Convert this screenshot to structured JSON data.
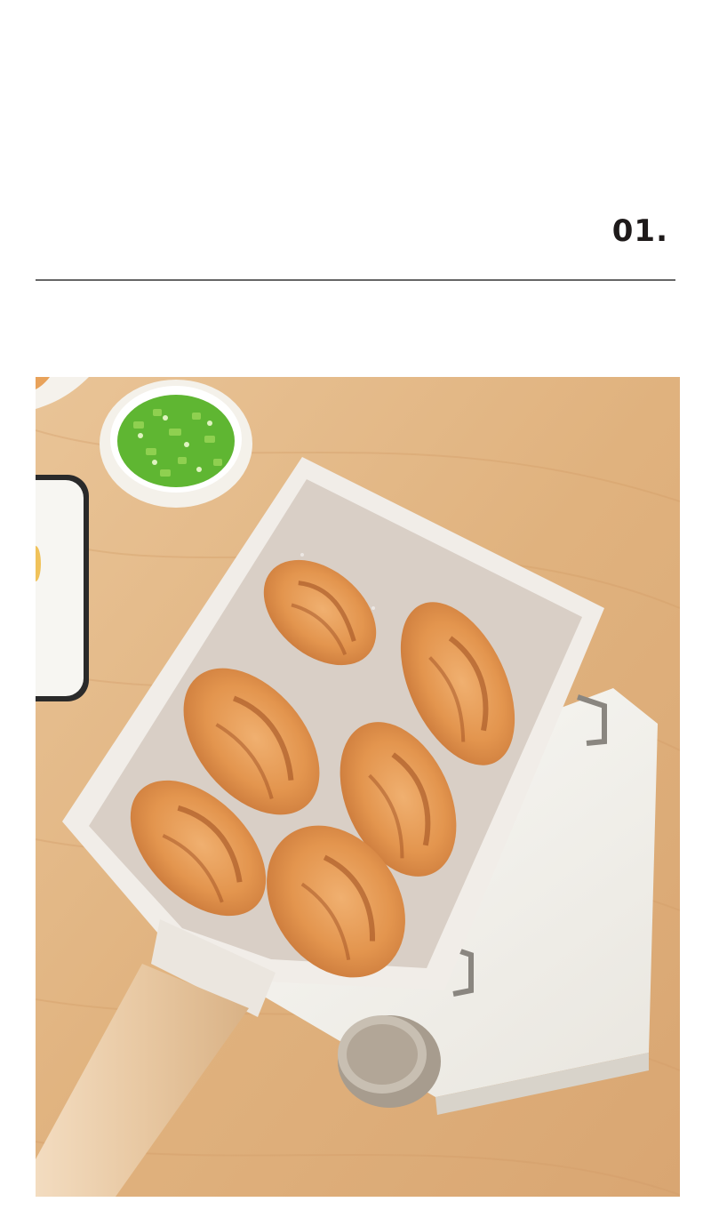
{
  "section": {
    "number": "01."
  },
  "photo": {
    "subject": "chicken-wings-in-square-frying-pan",
    "colors": {
      "table": "#e4b887",
      "pan_inner": "#d9cfc6",
      "wing": "#e39a55",
      "handle": "#efd2b0",
      "scallion": "#4fae2c"
    }
  }
}
